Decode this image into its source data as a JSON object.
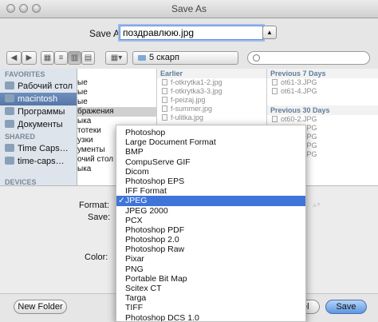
{
  "window": {
    "title": "Save As"
  },
  "save_as": {
    "label": "Save As:",
    "value": "поздравлюю.jpg"
  },
  "toolbar": {
    "location": "5 скарп"
  },
  "sidebar": {
    "favorites_header": "FAVORITES",
    "favorites": [
      "Рабочий стол",
      "macintosh",
      "Программы",
      "Документы"
    ],
    "selected_index": 1,
    "shared_header": "SHARED",
    "shared": [
      "Time Caps…",
      "time-caps…"
    ],
    "devices_header": "DEVICES"
  },
  "column1": {
    "rows": [
      "",
      "ые",
      "ые",
      "ые",
      "бражения",
      "ыка",
      "тотеки",
      "узки",
      "ументы",
      "очий стол",
      "ыка"
    ],
    "selected_index": 4
  },
  "column2": {
    "group": "Earlier",
    "files": [
      "f-otkrytka1-2.jpg",
      "f-otkrytka3-3.jpg",
      "f-peizaj.jpg",
      "f-summer.jpg",
      "f-ulitka.jpg"
    ]
  },
  "column3": {
    "group1": "Previous 7 Days",
    "files1": [
      "ot61-3.JPG",
      "ot61-4.JPG"
    ],
    "group2": "Previous 30 Days",
    "files2": [
      "ot60-2.JPG",
      "ot61-1.JPG",
      "ot61-1.JPG",
      "ot61-1.JPG",
      "ot61-1.JPG"
    ]
  },
  "options": {
    "format_label": "Format:",
    "save_label": "Save:",
    "color_label": "Color:"
  },
  "format_menu": {
    "selected": "JPEG",
    "items": [
      "Photoshop",
      "Large Document Format",
      "BMP",
      "CompuServe GIF",
      "Dicom",
      "Photoshop EPS",
      "IFF Format",
      "JPEG",
      "JPEG 2000",
      "PCX",
      "Photoshop PDF",
      "Photoshop 2.0",
      "Photoshop Raw",
      "Pixar",
      "PNG",
      "Portable Bit Map",
      "Scitex CT",
      "Targa",
      "TIFF",
      "Photoshop DCS 1.0"
    ]
  },
  "buttons": {
    "new_folder": "New Folder",
    "cancel": "Cancel",
    "save": "Save"
  }
}
